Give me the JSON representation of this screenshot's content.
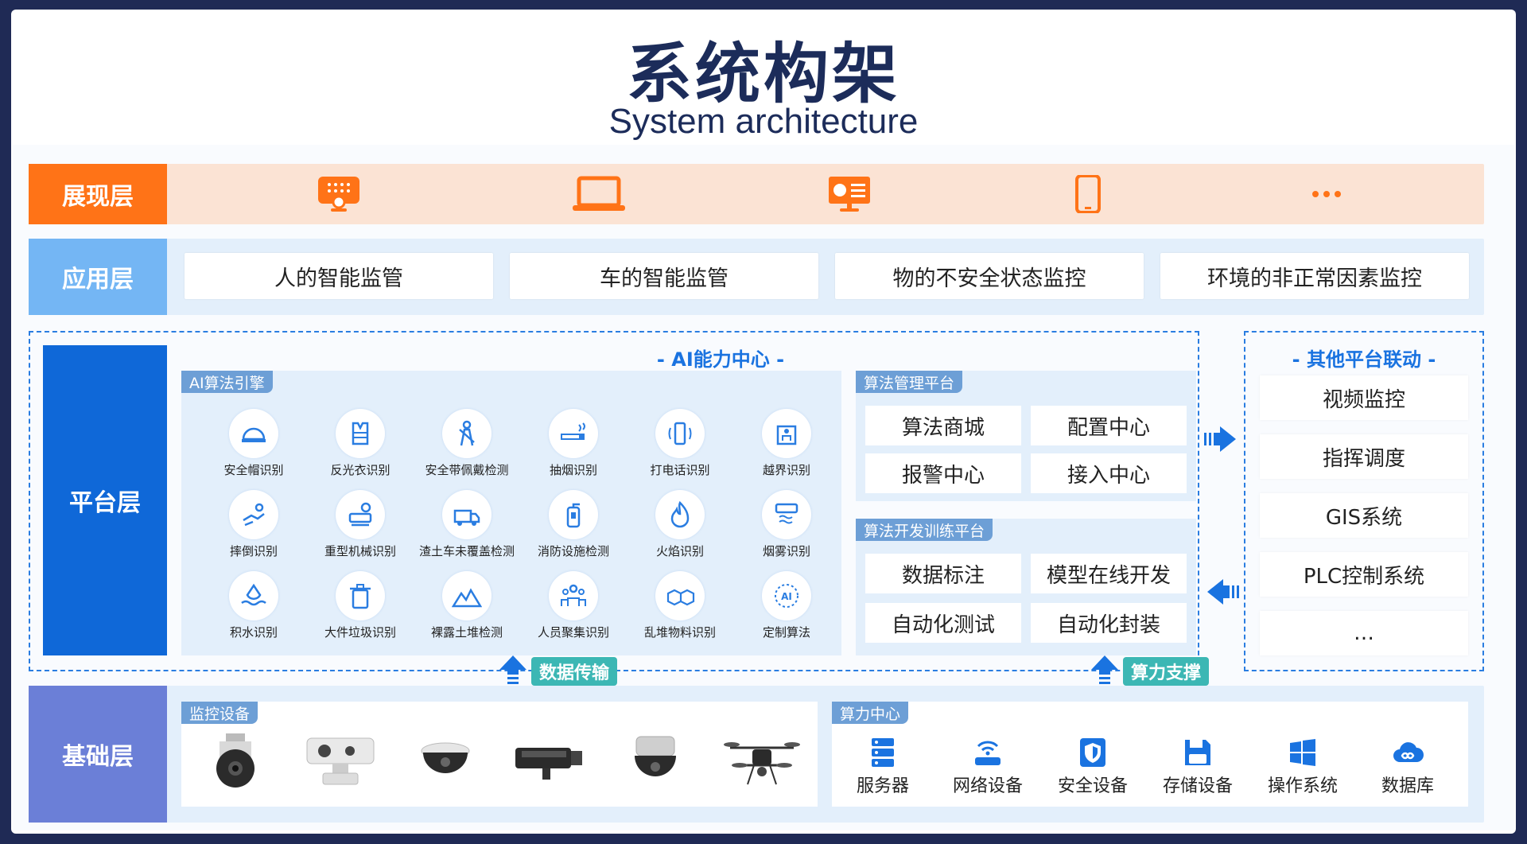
{
  "title": "系统构架",
  "subtitle": "System architecture",
  "layers": {
    "presentation": "展现层",
    "application": "应用层",
    "platform": "平台层",
    "base": "基础层"
  },
  "presentation_icons": [
    "display-panel-icon",
    "laptop-icon",
    "monitor-icon",
    "phone-icon",
    "more-icon"
  ],
  "colors": {
    "presentation": "#ff7317",
    "application": "#74b6f4",
    "platform": "#0f68d8",
    "base": "#6b7fd7",
    "accent": "#1a73e0",
    "teal": "#3cb7b4"
  },
  "application_items": [
    "人的智能监管",
    "车的智能监管",
    "物的不安全状态监控",
    "环境的非正常因素监控"
  ],
  "ai_center_title": "- AI能力中心 -",
  "ai_engine": {
    "title": "AI算法引擎",
    "algorithms": [
      "安全帽识别",
      "反光衣识别",
      "安全带佩戴检测",
      "抽烟识别",
      "打电话识别",
      "越界识别",
      "摔倒识别",
      "重型机械识别",
      "渣土车未覆盖检测",
      "消防设施检测",
      "火焰识别",
      "烟雾识别",
      "积水识别",
      "大件垃圾识别",
      "裸露土堆检测",
      "人员聚集识别",
      "乱堆物料识别",
      "定制算法"
    ]
  },
  "algo_mgmt": {
    "title": "算法管理平台",
    "items": [
      "算法商城",
      "配置中心",
      "报警中心",
      "接入中心"
    ]
  },
  "algo_dev": {
    "title": "算法开发训练平台",
    "items": [
      "数据标注",
      "模型在线开发",
      "自动化测试",
      "自动化封装"
    ]
  },
  "other_platforms": {
    "title": "- 其他平台联动 -",
    "items": [
      "视频监控",
      "指挥调度",
      "GIS系统",
      "PLC控制系统",
      "…"
    ]
  },
  "flows": {
    "data": "数据传输",
    "compute": "算力支撑"
  },
  "monitoring": {
    "title": "监控设备",
    "devices": [
      "ptz-dome-camera",
      "thermal-ptz-camera",
      "dome-camera",
      "bullet-camera",
      "panoramic-camera",
      "drone"
    ]
  },
  "compute_center": {
    "title": "算力中心",
    "items": [
      "服务器",
      "网络设备",
      "安全设备",
      "存储设备",
      "操作系统",
      "数据库"
    ]
  }
}
